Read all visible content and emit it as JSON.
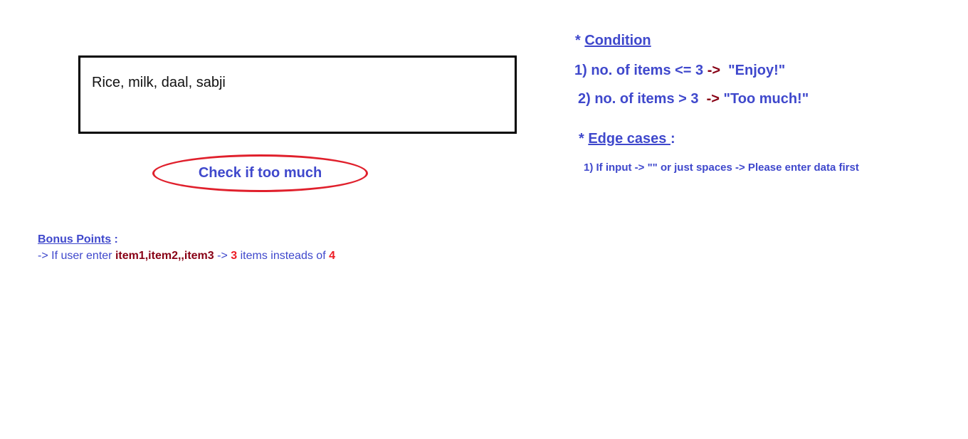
{
  "input": {
    "value": "Rice, milk, daal, sabji"
  },
  "check_button": {
    "label": "Check if too much"
  },
  "condition": {
    "star": "* ",
    "heading": "Condition",
    "line1": {
      "prefix": "1) no. of items <= 3 ",
      "arrow": "->",
      "result": "  \"Enjoy!\""
    },
    "line2": {
      "prefix": "2) no. of items > 3  ",
      "arrow": "->",
      "result": " \"Too much!\""
    }
  },
  "edge_cases": {
    "star": "* ",
    "heading": "Edge cases ",
    "colon": ":",
    "line1": "1) If input -> \"\" or just spaces -> Please enter data first"
  },
  "bonus": {
    "heading": "Bonus Points",
    "colon": " :",
    "line": {
      "part1": "-> If user enter ",
      "example": "item1,item2,,item3",
      "part2": " -> ",
      "count_correct": "3",
      "part3": " items insteads of ",
      "count_wrong": "4"
    }
  },
  "colors": {
    "text_blue": "#3f48cc",
    "arrow_dark_red": "#880015",
    "highlight_red": "#ed1c24",
    "button_outline_red": "#e0202c",
    "input_border": "#000000"
  }
}
